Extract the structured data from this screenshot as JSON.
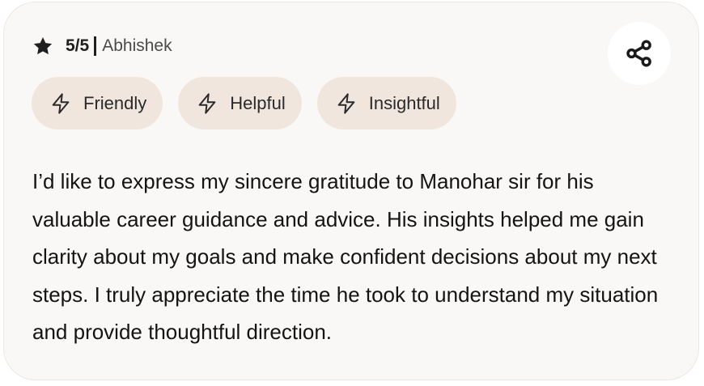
{
  "review": {
    "rating": "5/5",
    "reviewer": "Abhishek",
    "tags": [
      {
        "label": "Friendly",
        "icon": "bolt-icon"
      },
      {
        "label": "Helpful",
        "icon": "bolt-icon"
      },
      {
        "label": "Insightful",
        "icon": "bolt-icon"
      }
    ],
    "text": "I’d like to express my sincere gratitude to Manohar sir for his valuable career guidance and advice. His insights helped me gain clarity about my goals and make confident decisions about my next steps. I truly appreciate the time he took to understand my situation and provide thoughtful direction."
  },
  "icons": {
    "rating": "star-icon",
    "share": "share-icon"
  },
  "colors": {
    "card_background": "#faf8f6",
    "tag_background": "#f0e6dd",
    "share_button_background": "#ffffff",
    "text": "#141414"
  }
}
